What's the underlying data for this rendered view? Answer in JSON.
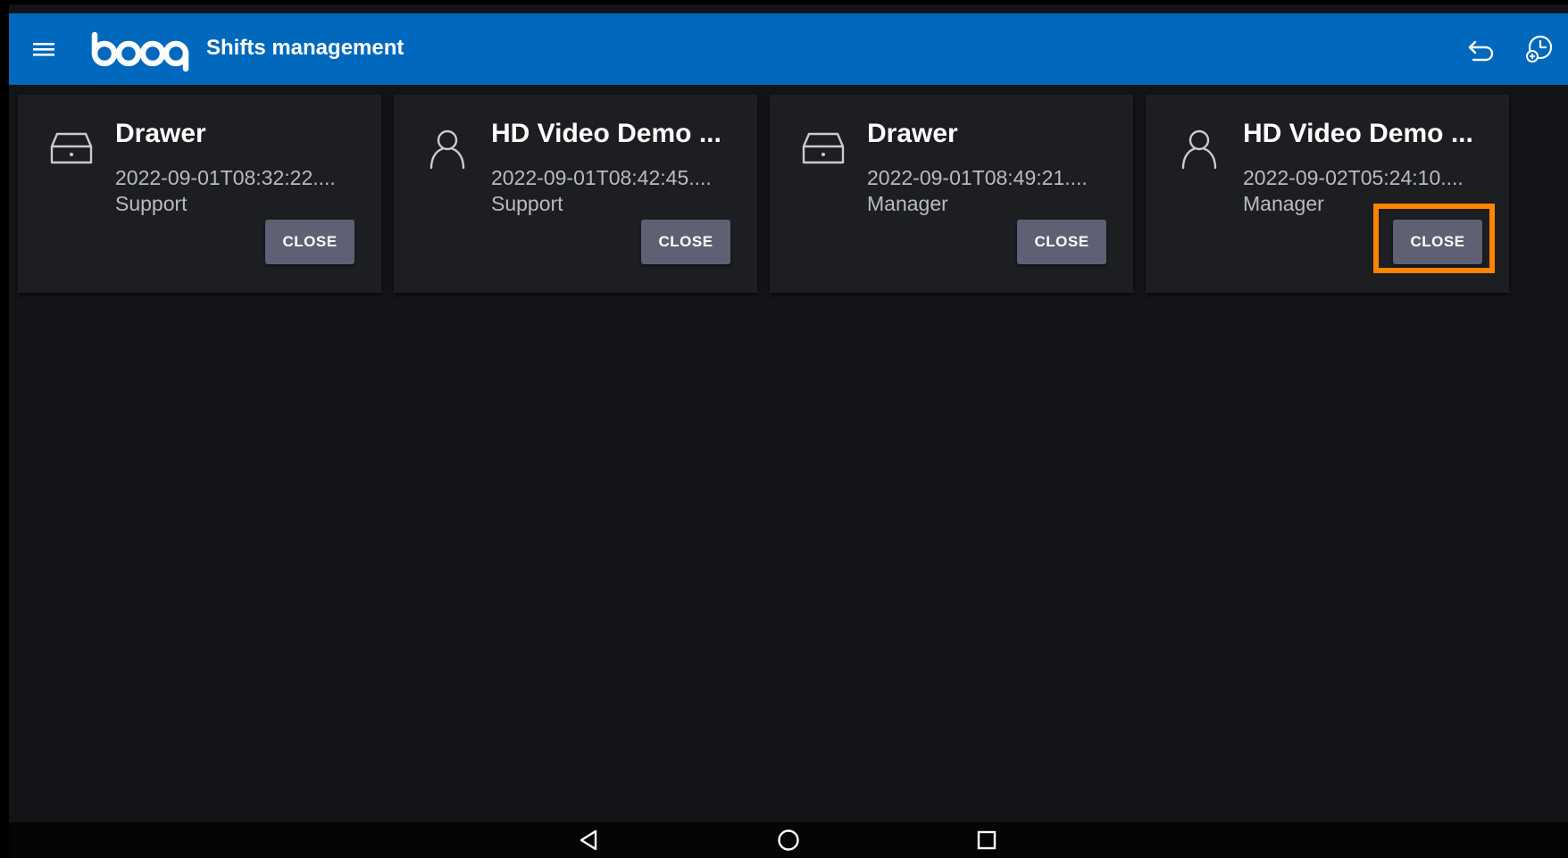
{
  "app": {
    "brand": "booq",
    "title": "Shifts management"
  },
  "icons": {
    "menu": "hamburger-menu-icon",
    "back": "undo-arrow-icon",
    "shifts": "clock-history-icon",
    "drawer": "cash-drawer-icon",
    "user": "person-icon"
  },
  "colors": {
    "appbar": "#0068bd",
    "background": "#121418",
    "card": "#1c1e22",
    "button": "#5f6073",
    "highlight": "#ff8400"
  },
  "shifts": [
    {
      "icon": "cash-drawer-icon",
      "title": "Drawer",
      "date": "2022-09-01T08:32:22....",
      "role": "Support",
      "button": "CLOSE"
    },
    {
      "icon": "person-icon",
      "title": "HD Video Demo ...",
      "date": "2022-09-01T08:42:45....",
      "role": "Support",
      "button": "CLOSE"
    },
    {
      "icon": "cash-drawer-icon",
      "title": "Drawer",
      "date": "2022-09-01T08:49:21....",
      "role": "Manager",
      "button": "CLOSE"
    },
    {
      "icon": "person-icon",
      "title": "HD Video Demo ...",
      "date": "2022-09-02T05:24:10....",
      "role": "Manager",
      "button": "CLOSE"
    }
  ],
  "navbar": {
    "back": "nav-back-icon",
    "home": "nav-home-icon",
    "recents": "nav-recents-icon"
  }
}
